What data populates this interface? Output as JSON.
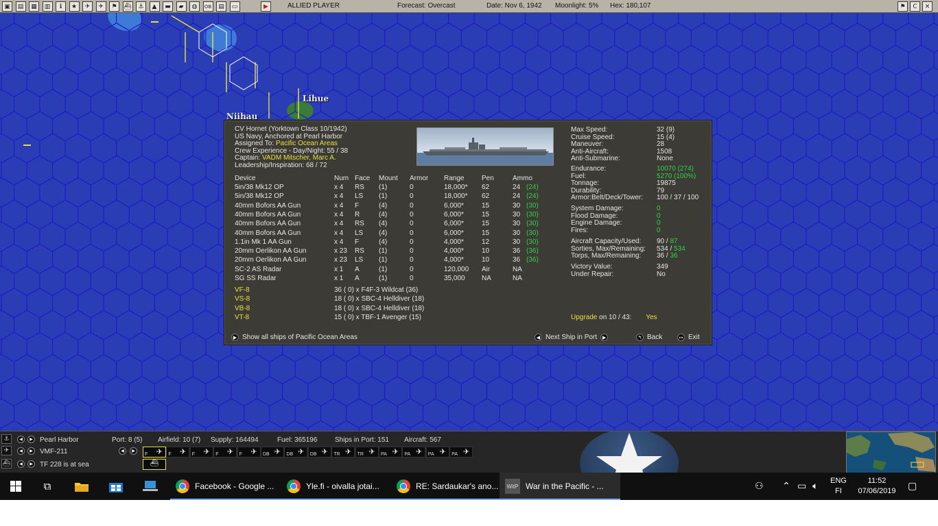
{
  "topbar": {
    "icons": [
      "window-icon",
      "document-icon",
      "bases-icon",
      "list-icon",
      "info-icon",
      "star-icon",
      "aircraft-icon",
      "plane-red-icon",
      "flag-icon",
      "ship-icon",
      "sub-icon",
      "chart-icon",
      "truck-icon",
      "transport-icon",
      "globe-icon",
      "ob-icon",
      "report-icon",
      "screen-icon",
      "end-turn-icon"
    ],
    "player": "ALLIED PLAYER",
    "forecast": "Forecast: Overcast",
    "date": "Date: Nov 6, 1942",
    "moonlight": "Moonlight: 5%",
    "hex": "Hex: 180,107",
    "right_icons": [
      "flag-icon",
      "c-icon",
      "close-icon"
    ]
  },
  "map": {
    "places": [
      "Lihue",
      "Niihau"
    ],
    "colors": {
      "sea": "#2b3db4",
      "grid": "#1a1ac8",
      "coast": "#e6e63c",
      "land": "#3a7a3a"
    }
  },
  "ship": {
    "name_line": "CV Hornet (Yorktown Class 10/1942)",
    "status_line": "US Navy, Anchored at Pearl Harbor",
    "assigned_label": "Assigned To:",
    "assigned_value": "Pacific Ocean Areas",
    "experience": "Crew Experience - Day/Night: 55 / 38",
    "captain_label": "Captain:",
    "captain_value": "VADM Mitscher, Marc A.",
    "leadership": "Leadership/Inspiration: 68 / 72",
    "columns": [
      "Device",
      "Num",
      "Face",
      "Mount",
      "Armor",
      "Range",
      "Pen",
      "Ammo"
    ],
    "devices": [
      {
        "device": "5in/38 Mk12 OP",
        "num": "x 4",
        "face": "RS",
        "mount": "(1)",
        "armor": "0",
        "range": "18,000*",
        "pen": "62",
        "ammo": "24",
        "ammo_max": "(24)"
      },
      {
        "device": "5in/38 Mk12 OP",
        "num": "x 4",
        "face": "LS",
        "mount": "(1)",
        "armor": "0",
        "range": "18,000*",
        "pen": "62",
        "ammo": "24",
        "ammo_max": "(24)"
      },
      {
        "device": "40mm Bofors AA Gun",
        "num": "x 4",
        "face": "F",
        "mount": "(4)",
        "armor": "0",
        "range": "6,000*",
        "pen": "15",
        "ammo": "30",
        "ammo_max": "(30)"
      },
      {
        "device": "40mm Bofors AA Gun",
        "num": "x 4",
        "face": "R",
        "mount": "(4)",
        "armor": "0",
        "range": "6,000*",
        "pen": "15",
        "ammo": "30",
        "ammo_max": "(30)"
      },
      {
        "device": "40mm Bofors AA Gun",
        "num": "x 4",
        "face": "RS",
        "mount": "(4)",
        "armor": "0",
        "range": "6,000*",
        "pen": "15",
        "ammo": "30",
        "ammo_max": "(30)"
      },
      {
        "device": "40mm Bofors AA Gun",
        "num": "x 4",
        "face": "LS",
        "mount": "(4)",
        "armor": "0",
        "range": "6,000*",
        "pen": "15",
        "ammo": "30",
        "ammo_max": "(30)"
      },
      {
        "device": "1.1in Mk 1 AA Gun",
        "num": "x 4",
        "face": "F",
        "mount": "(4)",
        "armor": "0",
        "range": "4,000*",
        "pen": "12",
        "ammo": "30",
        "ammo_max": "(30)"
      },
      {
        "device": "20mm Oerlikon AA Gun",
        "num": "x 23",
        "face": "RS",
        "mount": "(1)",
        "armor": "0",
        "range": "4,000*",
        "pen": "10",
        "ammo": "36",
        "ammo_max": "(36)"
      },
      {
        "device": "20mm Oerlikon AA Gun",
        "num": "x 23",
        "face": "LS",
        "mount": "(1)",
        "armor": "0",
        "range": "4,000*",
        "pen": "10",
        "ammo": "36",
        "ammo_max": "(36)"
      },
      {
        "device": "SC-2 AS Radar",
        "num": "x 1",
        "face": "A",
        "mount": "(1)",
        "armor": "0",
        "range": "120,000",
        "pen": "Air",
        "ammo": "NA",
        "ammo_max": ""
      },
      {
        "device": "SG SS Radar",
        "num": "x 1",
        "face": "A",
        "mount": "(1)",
        "armor": "0",
        "range": "35,000",
        "pen": "NA",
        "ammo": "NA",
        "ammo_max": ""
      }
    ],
    "air_groups": [
      {
        "unit": "VF-8",
        "desc": "36 ( 0) x F4F-3 Wildcat (36)"
      },
      {
        "unit": "VS-8",
        "desc": "18 ( 0) x SBC-4 Helldiver (18)"
      },
      {
        "unit": "VB-8",
        "desc": "18 ( 0) x SBC-4 Helldiver (18)"
      },
      {
        "unit": "VT-8",
        "desc": "15 ( 0) x TBF-1 Avenger (15)"
      }
    ],
    "stats": [
      {
        "k": "Max Speed:",
        "v": "32 (9)"
      },
      {
        "k": "Cruise Speed:",
        "v": "15 (4)"
      },
      {
        "k": "Maneuver:",
        "v": "28"
      },
      {
        "k": "Anti-Aircraft:",
        "v": "1508"
      },
      {
        "k": "Anti-Submarine:",
        "v": "None"
      },
      {
        "k": "Endurance:",
        "v": "10070 (274)",
        "green": true
      },
      {
        "k": "Fuel:",
        "v": "5270 (100%)",
        "green": true
      },
      {
        "k": "Tonnage:",
        "v": "19875"
      },
      {
        "k": "Durability:",
        "v": "79"
      },
      {
        "k": "Armor:Belt/Deck/Tower:",
        "v": "100 / 37 / 100"
      },
      {
        "k": "System Damage:",
        "v": "0",
        "green": true
      },
      {
        "k": "Flood Damage:",
        "v": "0",
        "green": true
      },
      {
        "k": "Engine Damage:",
        "v": "0",
        "green": true
      },
      {
        "k": "Fires:",
        "v": "0",
        "green": true
      },
      {
        "k": "Aircraft Capacity/Used:",
        "v": "90 / ",
        "v2": "87"
      },
      {
        "k": "Sorties, Max/Remaining:",
        "v": "534 / ",
        "v2": "534"
      },
      {
        "k": "Torps, Max/Remaining:",
        "v": "36 / ",
        "v2": "36"
      },
      {
        "k": "Victory Value:",
        "v": "349"
      },
      {
        "k": "Under Repair:",
        "v": "No"
      }
    ],
    "upgrade_label": "Upgrade",
    "upgrade_date": "on 10 / 43:",
    "upgrade_value": "Yes",
    "show_all_label": "Show all ships of Pacific Ocean Areas",
    "next_ship_label": "Next Ship in Port",
    "back_label": "Back",
    "exit_label": "Exit"
  },
  "bottombar": {
    "location": "Pearl Harbor",
    "port": "Port: 8 (5)",
    "airfield": "Airfield: 10 (7)",
    "supply": "Supply: 164494",
    "fuel": "Fuel: 365196",
    "ships_in_port": "Ships in Port: 151",
    "aircraft": "Aircraft: 567",
    "unit": "VMF-211",
    "task_force": "TF 228 is at sea",
    "plane_types": [
      "F",
      "F",
      "F",
      "F",
      "F",
      "DB",
      "DB",
      "DB",
      "TR",
      "TR",
      "PA",
      "PA",
      "PA",
      "PA"
    ]
  },
  "taskbar": {
    "apps": [
      {
        "label": "Facebook - Google ..."
      },
      {
        "label": "Yle.fi - oivalla jotai..."
      },
      {
        "label": "RE: Sardaukar's ano..."
      },
      {
        "label": "War in the Pacific - ...",
        "active": true
      }
    ],
    "lang": "ENG",
    "region": "FI",
    "time": "11:52",
    "date": "07/06/2019"
  }
}
